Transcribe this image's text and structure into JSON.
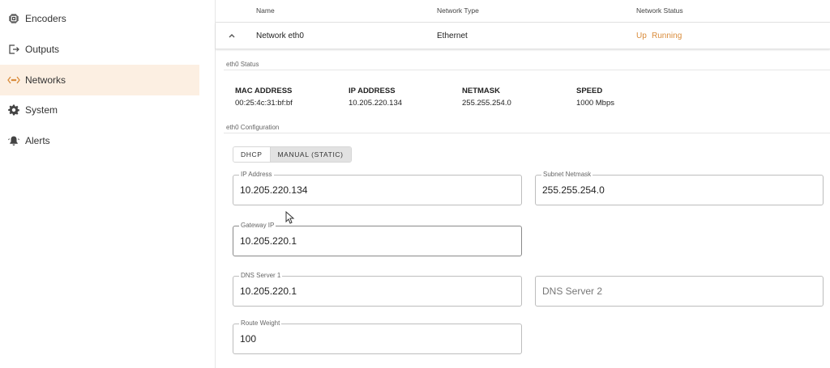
{
  "sidebar": {
    "items": [
      {
        "label": "Encoders",
        "icon": "chip-icon"
      },
      {
        "label": "Outputs",
        "icon": "output-icon"
      },
      {
        "label": "Networks",
        "icon": "network-icon",
        "active": true
      },
      {
        "label": "System",
        "icon": "gear-icon"
      },
      {
        "label": "Alerts",
        "icon": "bell-icon"
      }
    ]
  },
  "table": {
    "headers": {
      "name": "Name",
      "type": "Network Type",
      "status": "Network Status"
    },
    "row": {
      "name": "Network eth0",
      "type": "Ethernet",
      "status_up": "Up",
      "status_running": "Running"
    }
  },
  "status": {
    "section_label": "eth0 Status",
    "mac": {
      "title": "MAC ADDRESS",
      "value": "00:25:4c:31:bf:bf"
    },
    "ip": {
      "title": "IP ADDRESS",
      "value": "10.205.220.134"
    },
    "netmask": {
      "title": "NETMASK",
      "value": "255.255.254.0"
    },
    "speed": {
      "title": "SPEED",
      "value": "1000 Mbps"
    }
  },
  "config": {
    "section_label": "eth0 Configuration",
    "mode_dhcp": "DHCP",
    "mode_manual": "MANUAL (STATIC)",
    "ip_address": {
      "label": "IP Address",
      "value": "10.205.220.134"
    },
    "subnet": {
      "label": "Subnet Netmask",
      "value": "255.255.254.0"
    },
    "gateway": {
      "label": "Gateway IP",
      "value": "10.205.220.1"
    },
    "dns1": {
      "label": "DNS Server 1",
      "value": "10.205.220.1"
    },
    "dns2": {
      "placeholder": "DNS Server 2"
    },
    "route_weight": {
      "label": "Route Weight",
      "value": "100"
    }
  },
  "colors": {
    "accent": "#d98b3a",
    "active_bg": "#fcefe2"
  }
}
